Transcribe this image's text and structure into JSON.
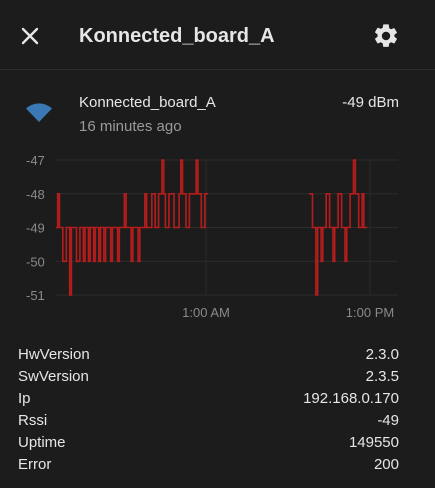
{
  "header": {
    "title": "Konnected_board_A"
  },
  "entity": {
    "name": "Konnected_board_A",
    "last_changed": "16 minutes ago",
    "value": "-49 dBm"
  },
  "chart_data": {
    "type": "line",
    "ylabels": [
      "-47",
      "-48",
      "-49",
      "-50",
      "-51"
    ],
    "xlabels": [
      "1:00 AM",
      "1:00 PM"
    ],
    "ylim": [
      -51,
      -47
    ],
    "color": "#b71c1c",
    "series": [
      {
        "segments": [
          [
            [
              0.0,
              -49
            ],
            [
              0.005,
              -49
            ],
            [
              0.005,
              -48
            ],
            [
              0.01,
              -48
            ],
            [
              0.01,
              -49
            ],
            [
              0.02,
              -49
            ],
            [
              0.02,
              -50
            ],
            [
              0.03,
              -50
            ],
            [
              0.03,
              -49
            ],
            [
              0.04,
              -49
            ],
            [
              0.04,
              -51
            ],
            [
              0.045,
              -51
            ],
            [
              0.045,
              -49
            ],
            [
              0.06,
              -49
            ],
            [
              0.06,
              -50
            ],
            [
              0.07,
              -50
            ],
            [
              0.07,
              -49
            ],
            [
              0.08,
              -49
            ],
            [
              0.08,
              -50
            ],
            [
              0.085,
              -50
            ],
            [
              0.085,
              -49
            ],
            [
              0.095,
              -49
            ],
            [
              0.095,
              -50
            ],
            [
              0.1,
              -50
            ],
            [
              0.1,
              -49
            ],
            [
              0.11,
              -49
            ],
            [
              0.11,
              -50
            ],
            [
              0.115,
              -50
            ],
            [
              0.115,
              -49
            ],
            [
              0.125,
              -49
            ],
            [
              0.125,
              -50
            ],
            [
              0.13,
              -50
            ],
            [
              0.13,
              -49
            ],
            [
              0.14,
              -49
            ],
            [
              0.14,
              -50
            ],
            [
              0.145,
              -50
            ],
            [
              0.145,
              -49
            ],
            [
              0.16,
              -49
            ],
            [
              0.16,
              -50
            ],
            [
              0.165,
              -50
            ],
            [
              0.165,
              -49
            ],
            [
              0.18,
              -49
            ],
            [
              0.18,
              -50
            ],
            [
              0.185,
              -50
            ],
            [
              0.185,
              -49
            ],
            [
              0.2,
              -49
            ],
            [
              0.2,
              -48
            ],
            [
              0.205,
              -48
            ],
            [
              0.205,
              -49
            ],
            [
              0.22,
              -49
            ],
            [
              0.22,
              -50
            ],
            [
              0.225,
              -50
            ],
            [
              0.225,
              -49
            ],
            [
              0.24,
              -49
            ],
            [
              0.24,
              -50
            ],
            [
              0.245,
              -50
            ],
            [
              0.245,
              -49
            ],
            [
              0.26,
              -49
            ],
            [
              0.26,
              -48
            ],
            [
              0.265,
              -48
            ],
            [
              0.265,
              -49
            ],
            [
              0.28,
              -49
            ],
            [
              0.28,
              -48
            ],
            [
              0.29,
              -48
            ],
            [
              0.29,
              -49
            ],
            [
              0.3,
              -49
            ],
            [
              0.3,
              -48
            ],
            [
              0.31,
              -48
            ],
            [
              0.31,
              -47
            ],
            [
              0.315,
              -47
            ],
            [
              0.315,
              -48
            ],
            [
              0.32,
              -48
            ],
            [
              0.32,
              -49
            ],
            [
              0.33,
              -49
            ],
            [
              0.33,
              -48
            ],
            [
              0.345,
              -48
            ],
            [
              0.345,
              -49
            ],
            [
              0.36,
              -49
            ],
            [
              0.36,
              -48
            ],
            [
              0.365,
              -48
            ],
            [
              0.365,
              -47
            ],
            [
              0.37,
              -47
            ],
            [
              0.37,
              -48
            ],
            [
              0.38,
              -48
            ],
            [
              0.38,
              -49
            ],
            [
              0.39,
              -49
            ],
            [
              0.39,
              -48
            ],
            [
              0.41,
              -48
            ],
            [
              0.41,
              -47
            ],
            [
              0.415,
              -47
            ],
            [
              0.415,
              -48
            ],
            [
              0.425,
              -48
            ],
            [
              0.425,
              -49
            ],
            [
              0.435,
              -49
            ],
            [
              0.435,
              -48
            ],
            [
              0.445,
              -48
            ]
          ],
          [
            [
              0.74,
              -48
            ],
            [
              0.75,
              -48
            ],
            [
              0.75,
              -49
            ],
            [
              0.76,
              -49
            ],
            [
              0.76,
              -51
            ],
            [
              0.765,
              -51
            ],
            [
              0.765,
              -49
            ],
            [
              0.775,
              -49
            ],
            [
              0.775,
              -50
            ],
            [
              0.78,
              -50
            ],
            [
              0.78,
              -49
            ],
            [
              0.79,
              -49
            ],
            [
              0.79,
              -48
            ],
            [
              0.8,
              -48
            ],
            [
              0.8,
              -49
            ],
            [
              0.81,
              -49
            ],
            [
              0.81,
              -50
            ],
            [
              0.815,
              -50
            ],
            [
              0.815,
              -49
            ],
            [
              0.825,
              -49
            ],
            [
              0.825,
              -48
            ],
            [
              0.835,
              -48
            ],
            [
              0.835,
              -49
            ],
            [
              0.845,
              -49
            ],
            [
              0.845,
              -50
            ],
            [
              0.85,
              -50
            ],
            [
              0.85,
              -49
            ],
            [
              0.86,
              -49
            ],
            [
              0.86,
              -48
            ],
            [
              0.87,
              -48
            ],
            [
              0.87,
              -47
            ],
            [
              0.875,
              -47
            ],
            [
              0.875,
              -48
            ],
            [
              0.885,
              -48
            ],
            [
              0.885,
              -49
            ],
            [
              0.895,
              -49
            ],
            [
              0.895,
              -48
            ],
            [
              0.9,
              -48
            ],
            [
              0.9,
              -49
            ],
            [
              0.91,
              -49
            ]
          ]
        ]
      }
    ]
  },
  "attributes": [
    {
      "key": "HwVersion",
      "value": "2.3.0"
    },
    {
      "key": "SwVersion",
      "value": "2.3.5"
    },
    {
      "key": "Ip",
      "value": "192.168.0.170"
    },
    {
      "key": "Rssi",
      "value": "-49"
    },
    {
      "key": "Uptime",
      "value": "149550"
    },
    {
      "key": "Error",
      "value": "200"
    }
  ]
}
